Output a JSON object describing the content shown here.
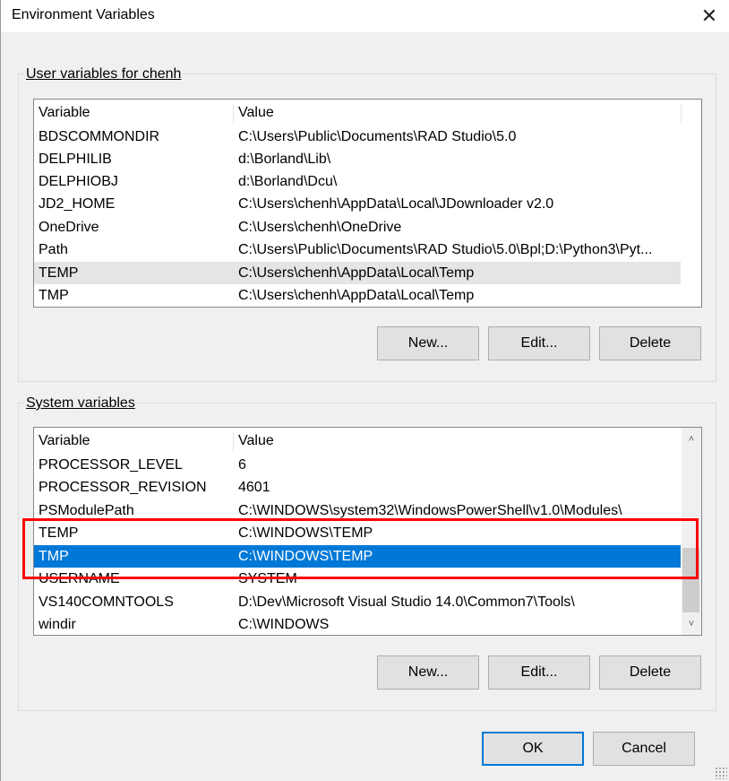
{
  "window": {
    "title": "Environment Variables",
    "close_glyph": "✕"
  },
  "user_section": {
    "label": "User variables for chenh",
    "columns": [
      "Variable",
      "Value"
    ],
    "rows": [
      {
        "variable": "BDSCOMMONDIR",
        "value": "C:\\Users\\Public\\Documents\\RAD Studio\\5.0"
      },
      {
        "variable": "DELPHILIB",
        "value": "d:\\Borland\\Lib\\"
      },
      {
        "variable": "DELPHIOBJ",
        "value": "d:\\Borland\\Dcu\\"
      },
      {
        "variable": "JD2_HOME",
        "value": "C:\\Users\\chenh\\AppData\\Local\\JDownloader v2.0"
      },
      {
        "variable": "OneDrive",
        "value": "C:\\Users\\chenh\\OneDrive"
      },
      {
        "variable": "Path",
        "value": "C:\\Users\\Public\\Documents\\RAD Studio\\5.0\\Bpl;D:\\Python3\\Pyt..."
      },
      {
        "variable": "TEMP",
        "value": "C:\\Users\\chenh\\AppData\\Local\\Temp"
      },
      {
        "variable": "TMP",
        "value": "C:\\Users\\chenh\\AppData\\Local\\Temp"
      }
    ],
    "buttons": {
      "new": "New...",
      "edit": "Edit...",
      "delete": "Delete"
    }
  },
  "system_section": {
    "label": "System variables",
    "columns": [
      "Variable",
      "Value"
    ],
    "rows": [
      {
        "variable": "PROCESSOR_LEVEL",
        "value": "6"
      },
      {
        "variable": "PROCESSOR_REVISION",
        "value": "4601"
      },
      {
        "variable": "PSModulePath",
        "value": "C:\\WINDOWS\\system32\\WindowsPowerShell\\v1.0\\Modules\\"
      },
      {
        "variable": "TEMP",
        "value": "C:\\WINDOWS\\TEMP"
      },
      {
        "variable": "TMP",
        "value": "C:\\WINDOWS\\TEMP"
      },
      {
        "variable": "USERNAME",
        "value": "SYSTEM"
      },
      {
        "variable": "VS140COMNTOOLS",
        "value": "D:\\Dev\\Microsoft Visual Studio 14.0\\Common7\\Tools\\"
      },
      {
        "variable": "windir",
        "value": "C:\\WINDOWS"
      }
    ],
    "buttons": {
      "new": "New...",
      "edit": "Edit...",
      "delete": "Delete"
    },
    "scroll_up_glyph": "˄",
    "scroll_down_glyph": "˅"
  },
  "footer": {
    "ok": "OK",
    "cancel": "Cancel"
  },
  "colors": {
    "selection_blue": "#0078d7",
    "selection_gray": "#e5e5e5",
    "highlight_red": "#ff0000"
  }
}
